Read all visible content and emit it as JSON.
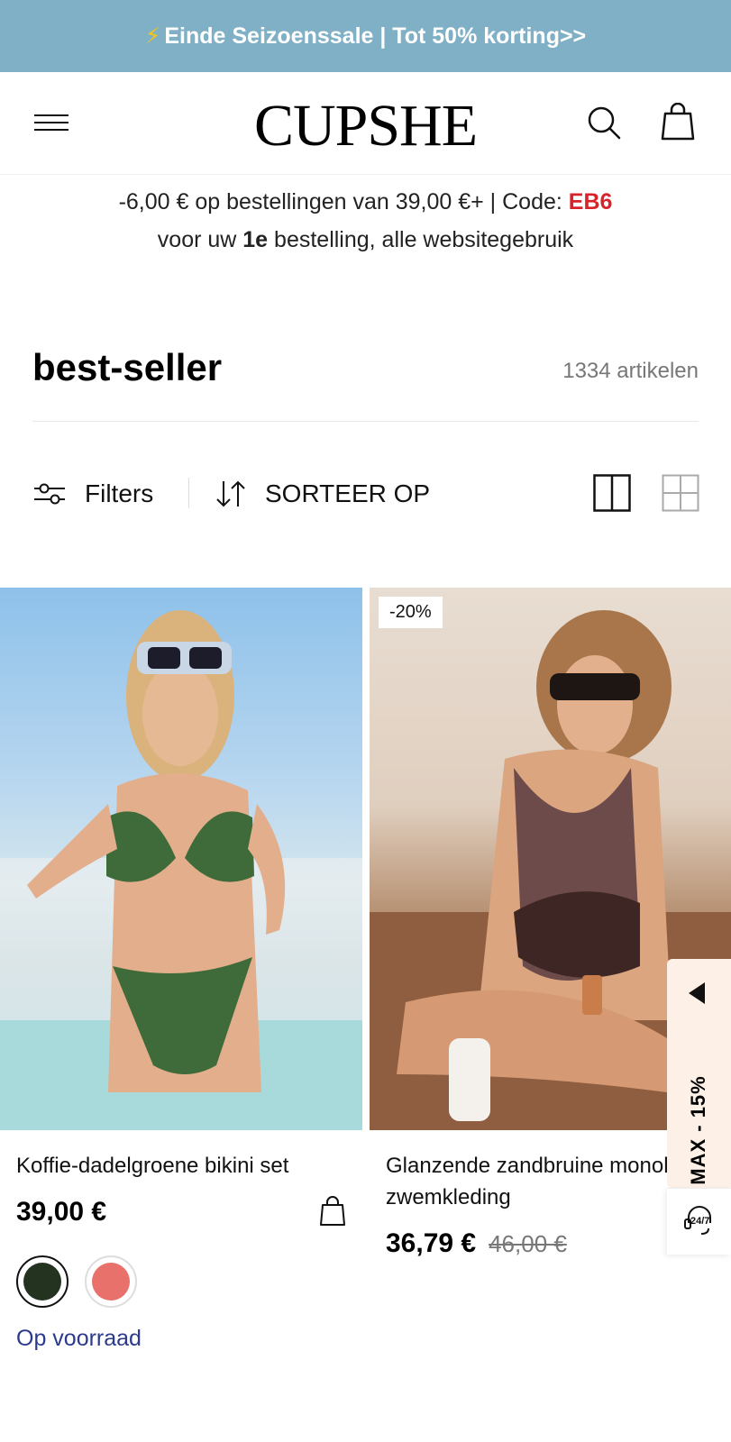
{
  "announcement": {
    "bolt": "⚡",
    "text": "Einde Seizoenssale | Tot 50% korting>>"
  },
  "header": {
    "logo": "CUPSHE",
    "menu_icon": "hamburger-icon",
    "search_icon": "search-icon",
    "bag_icon": "bag-icon"
  },
  "promo": {
    "line1_pre": "-6,00 € op bestellingen van 39,00 €+ | Code: ",
    "code": "EB6",
    "line2_pre": "voor uw ",
    "line2_bold": "1e",
    "line2_post": " bestelling, alle websitegebruik"
  },
  "listing": {
    "title": "best-seller",
    "count": "1334 artikelen"
  },
  "toolbar": {
    "filters_label": "Filters",
    "sort_label": "SORTEER OP"
  },
  "products": [
    {
      "name": "Koffie-dadelgroene bikini set",
      "price": "39,00 €",
      "swatches": [
        {
          "color": "#23331f",
          "selected": true
        },
        {
          "color": "#e8716b",
          "selected": false
        }
      ],
      "stock": "Op voorraad"
    },
    {
      "badge": "-20%",
      "name": "Glanzende zandbruine monokini zwemkleding",
      "price": "36,79 €",
      "old_price": "46,00 €"
    }
  ],
  "side_promo": {
    "text": "MAX - 15%"
  },
  "support": {
    "label": "24/7"
  }
}
